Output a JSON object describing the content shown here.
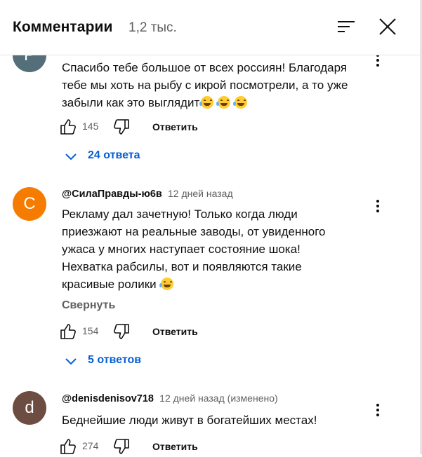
{
  "header": {
    "title": "Комментарии",
    "count": "1,2 тыс."
  },
  "comments": [
    {
      "avatar_letter": "P",
      "avatar_color": "#546e7a",
      "text": "Спасибо тебе большое от всех россиян! Благодаря тебе мы хоть на рыбу с икрой посмотрели, а то уже забыли как это выглядит",
      "likes": "145",
      "reply_label": "Ответить",
      "replies_label": "24 ответа"
    },
    {
      "avatar_letter": "C",
      "avatar_color": "#f57c00",
      "author": "@СилаПравды-ю6в",
      "time": "12 дней назад",
      "text": "Рекламу дал зачетную! Только когда люди приезжают на реальные заводы, от увиденного ужаса у многих наступает состояние шока! Нехватка рабсилы, вот и появляются такие красивые ролики",
      "collapse_label": "Свернуть",
      "likes": "154",
      "reply_label": "Ответить",
      "replies_label": "5 ответов"
    },
    {
      "avatar_letter": "d",
      "avatar_color": "#6d4c41",
      "author": "@denisdenisov718",
      "time": "12 дней назад (изменено)",
      "text": "Беднейшие люди живут в богатейших местах!",
      "likes": "274",
      "reply_label": "Ответить"
    }
  ],
  "icons": {
    "sort": "sort-icon",
    "close": "close-icon",
    "like": "thumbs-up-icon",
    "dislike": "thumbs-down-icon",
    "more": "more-vert-icon",
    "expand": "chevron-down-icon",
    "emoji": "laughing-tears-emoji"
  },
  "colors": {
    "link": "#065fd4",
    "secondary_text": "#606060"
  }
}
